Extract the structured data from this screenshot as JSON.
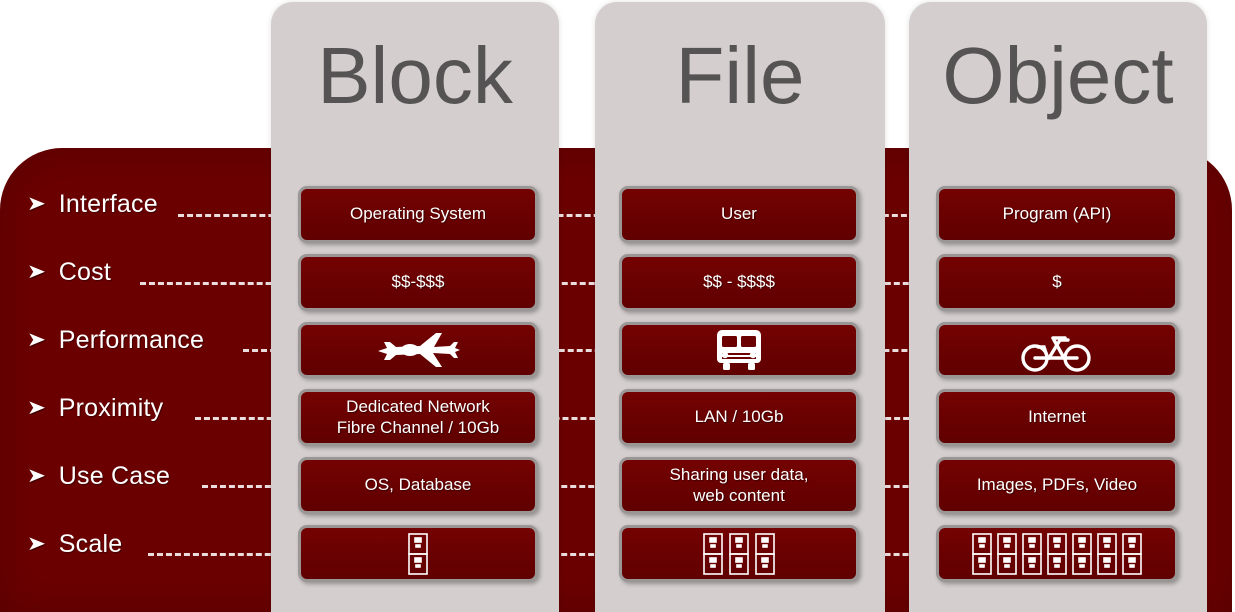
{
  "diagram": {
    "title": "Block vs File vs Object storage comparison",
    "colors": {
      "panel_red": "#6b0000",
      "column_gray": "#d4cece",
      "title_gray": "#555353",
      "cell_border": "#9b9696",
      "text_white": "#ffffff",
      "dash_white": "#f2e9e9"
    }
  },
  "criteria": {
    "bullet_glyph": "➤",
    "rows": [
      {
        "label": "Interface",
        "name": "interface"
      },
      {
        "label": "Cost",
        "name": "cost"
      },
      {
        "label": "Performance",
        "name": "performance"
      },
      {
        "label": "Proximity",
        "name": "proximity"
      },
      {
        "label": "Use Case",
        "name": "use-case"
      },
      {
        "label": "Scale",
        "name": "scale"
      }
    ]
  },
  "columns": [
    {
      "key": "block",
      "title": "Block",
      "cells": {
        "interface": {
          "type": "text",
          "value": "Operating  System"
        },
        "cost": {
          "type": "text",
          "value": "$$-$$$"
        },
        "performance": {
          "type": "icon",
          "icon": "airplane-icon",
          "value": ""
        },
        "proximity": {
          "type": "text",
          "value": "Dedicated Network\nFibre Channel  / 10Gb"
        },
        "use_case": {
          "type": "text",
          "value": "OS, Database"
        },
        "scale": {
          "type": "icon",
          "icon": "filing-cabinet-icon",
          "count": 1,
          "value": ""
        }
      }
    },
    {
      "key": "file",
      "title": "File",
      "cells": {
        "interface": {
          "type": "text",
          "value": "User"
        },
        "cost": {
          "type": "text",
          "value": "$$ - $$$$"
        },
        "performance": {
          "type": "icon",
          "icon": "bus-icon",
          "value": ""
        },
        "proximity": {
          "type": "text",
          "value": "LAN / 10Gb"
        },
        "use_case": {
          "type": "text",
          "value": "Sharing user data,\nweb content"
        },
        "scale": {
          "type": "icon",
          "icon": "filing-cabinet-icon",
          "count": 3,
          "value": ""
        }
      }
    },
    {
      "key": "object",
      "title": "Object",
      "cells": {
        "interface": {
          "type": "text",
          "value": "Program (API)"
        },
        "cost": {
          "type": "text",
          "value": "$"
        },
        "performance": {
          "type": "icon",
          "icon": "bicycle-icon",
          "value": ""
        },
        "proximity": {
          "type": "text",
          "value": "Internet"
        },
        "use_case": {
          "type": "text",
          "value": "Images, PDFs, Video"
        },
        "scale": {
          "type": "icon",
          "icon": "filing-cabinet-icon",
          "count": 7,
          "value": ""
        }
      }
    }
  ]
}
